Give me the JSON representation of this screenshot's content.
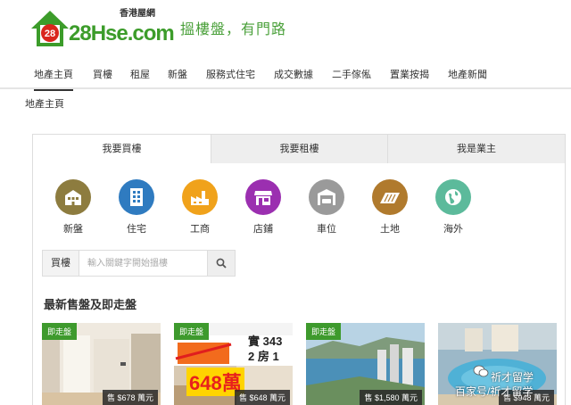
{
  "header": {
    "logo_number": "28",
    "logo_text": "28Hse.com",
    "logo_cn": "香港屋網",
    "slogan": "搵樓盤，有門路"
  },
  "nav": {
    "items": [
      {
        "label": "地產主頁",
        "active": true
      },
      {
        "label": "買樓"
      },
      {
        "label": "租屋"
      },
      {
        "label": "新盤"
      },
      {
        "label": "服務式住宅"
      },
      {
        "label": "成交數據"
      },
      {
        "label": "二手傢俬"
      },
      {
        "label": "置業按揭"
      },
      {
        "label": "地產新聞"
      }
    ]
  },
  "breadcrumb": "地產主頁",
  "tabs": [
    {
      "label": "我要買樓",
      "active": true
    },
    {
      "label": "我要租樓"
    },
    {
      "label": "我是業主"
    }
  ],
  "categories": [
    {
      "label": "新盤",
      "icon": "new-building-icon",
      "color": "#8d7c3f"
    },
    {
      "label": "住宅",
      "icon": "residential-icon",
      "color": "#2f7bc0"
    },
    {
      "label": "工商",
      "icon": "factory-icon",
      "color": "#f0a21b"
    },
    {
      "label": "店鋪",
      "icon": "shop-icon",
      "color": "#9b2fb0"
    },
    {
      "label": "車位",
      "icon": "parking-icon",
      "color": "#9a9a9a"
    },
    {
      "label": "土地",
      "icon": "land-icon",
      "color": "#b07a2d"
    },
    {
      "label": "海外",
      "icon": "globe-icon",
      "color": "#5cba9b"
    }
  ],
  "search": {
    "type_label": "買樓",
    "placeholder": "輸入關鍵字開始搵樓"
  },
  "section_title": "最新售盤及即走盤",
  "listings": [
    {
      "tag": "即走盤",
      "price": "售 $678 萬元"
    },
    {
      "tag": "即走盤",
      "price": "售 $648 萬元",
      "overlay": "648萬",
      "overlay_text_1": "實 343",
      "overlay_text_2": "2 房 1"
    },
    {
      "tag": "即走盤",
      "price": "售 $1,580 萬元"
    },
    {
      "tag": "",
      "price": "售 $948 萬元"
    }
  ],
  "watermark": {
    "top": "祈才留学",
    "bottom": "百家号/祈才留学"
  },
  "colors": {
    "brand_green": "#3c9c2a",
    "tag_green": "#3e9a2d"
  }
}
